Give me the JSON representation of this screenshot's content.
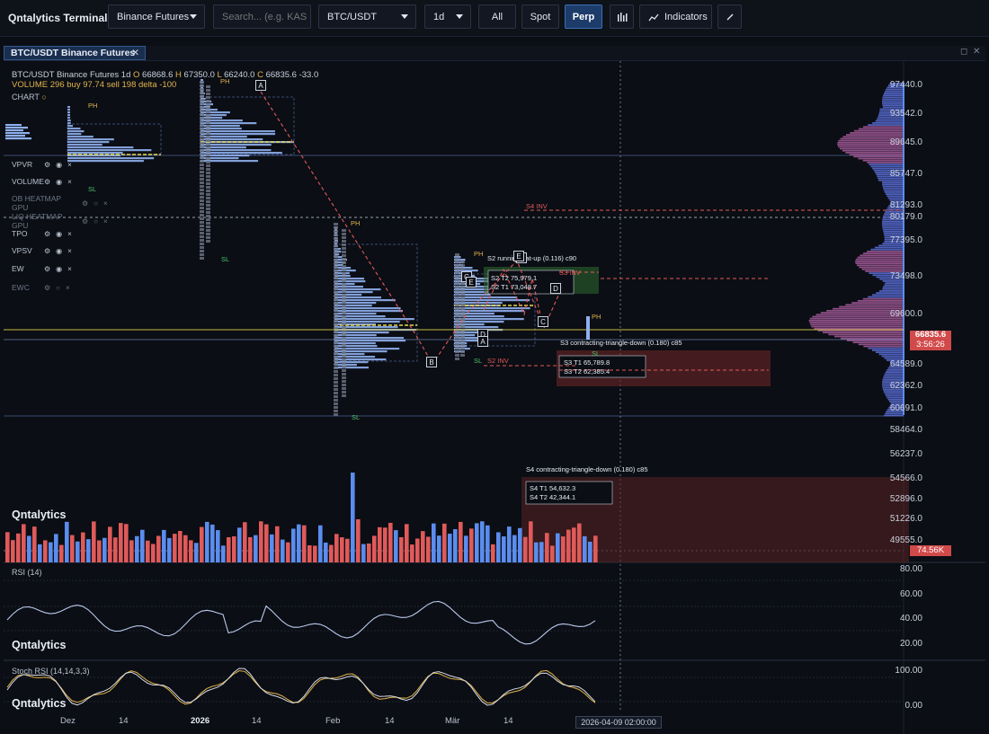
{
  "app": {
    "title": "Qntalytics Terminal"
  },
  "toolbar": {
    "exchange": "Binance Futures",
    "search_placeholder": "Search... (e.g. KAS",
    "symbol": "BTC/USDT",
    "interval": "1d",
    "filters": [
      "All",
      "Spot",
      "Perp"
    ],
    "active_filter": "Perp",
    "indicators_label": "Indicators"
  },
  "panel": {
    "tab_title": "BTC/USDT Binance Futures",
    "close_glyph": "✕",
    "maximize_glyph": "◻",
    "panel_close_glyph": "✕"
  },
  "legend": {
    "ohlc_prefix": "BTC/USDT Binance Futures 1d",
    "o_label": "O",
    "o": "66868.6",
    "h_label": "H",
    "h": "67350.0",
    "l_label": "L",
    "l": "66240.0",
    "c_label": "C",
    "c": "66835.6",
    "change": "-33.0",
    "volume_text": "VOLUME 296 buy 97.74 sell 198 delta -100",
    "chart_label": "CHART"
  },
  "indicators": [
    {
      "name": "VPVR",
      "enabled": true
    },
    {
      "name": "VOLUME",
      "enabled": true
    },
    {
      "name": "OB HEATMAP GPU",
      "enabled": false
    },
    {
      "name": "LIQ HEATMAP GPU",
      "enabled": false
    },
    {
      "name": "TPO",
      "enabled": true
    },
    {
      "name": "VPSV",
      "enabled": true
    },
    {
      "name": "EW",
      "enabled": true
    },
    {
      "name": "EWC",
      "enabled": false
    }
  ],
  "brand_watermark": "Qntalytics",
  "price_axis": [
    "97440.0",
    "93542.0",
    "89645.0",
    "85747.0",
    "81293.0",
    "80179.0",
    "77395.0",
    "73498.0",
    "69600.0",
    "64589.0",
    "62362.0",
    "60691.0",
    "58464.0",
    "56237.0",
    "54566.0",
    "52896.0",
    "51226.0",
    "49555.0"
  ],
  "last_price": {
    "value": "66835.6",
    "countdown": "3:56:26"
  },
  "volume_tag": "74.56K",
  "rsi": {
    "label": "RSI (14)",
    "axis": [
      "80.00",
      "60.00",
      "40.00",
      "20.00"
    ]
  },
  "stoch": {
    "label": "Stoch RSI (14,14,3,3)",
    "axis": [
      "100.00",
      "0.00"
    ]
  },
  "time_axis": [
    {
      "label": "Dez",
      "bold": false
    },
    {
      "label": "14",
      "bold": false
    },
    {
      "label": "2026",
      "bold": true
    },
    {
      "label": "14",
      "bold": false
    },
    {
      "label": "Feb",
      "bold": false
    },
    {
      "label": "14",
      "bold": false
    },
    {
      "label": "Mär",
      "bold": false
    },
    {
      "label": "14",
      "bold": false
    }
  ],
  "cursor_date": "2026-04-09 02:00:00",
  "annotations": {
    "ph": "PH",
    "sl": "SL",
    "s2_title": "S2 running-flat-up (0.116) c90",
    "s2_t2": "S2 T2 75,979.1",
    "s2_t1": "S2 T1 73,048.7",
    "s3_inv": "S3 INV",
    "s4_inv": "S4 INV",
    "s2_inv": "S2 INV",
    "s3_title": "S3 contracting-triangle-down (0.180) c85",
    "s3_t1": "S3 T1 65,789.8",
    "s3_t2": "S3 T2 62,385.4",
    "s4_title": "S4 contracting-triangle-down (0.180) c85",
    "s4_t1": "S4 T1 54,632.3",
    "s4_t2": "S4 T2 42,344.1",
    "wave_labels": [
      "A",
      "B",
      "C",
      "D",
      "E",
      "A",
      "B",
      "C",
      "D",
      "E"
    ]
  },
  "colors": {
    "up": "#5b8def",
    "down": "#e05a5a",
    "profile": "#8fb0ee",
    "poc": "#e8d84a",
    "grid": "#1a2130",
    "accent": "#3c6fb5"
  }
}
